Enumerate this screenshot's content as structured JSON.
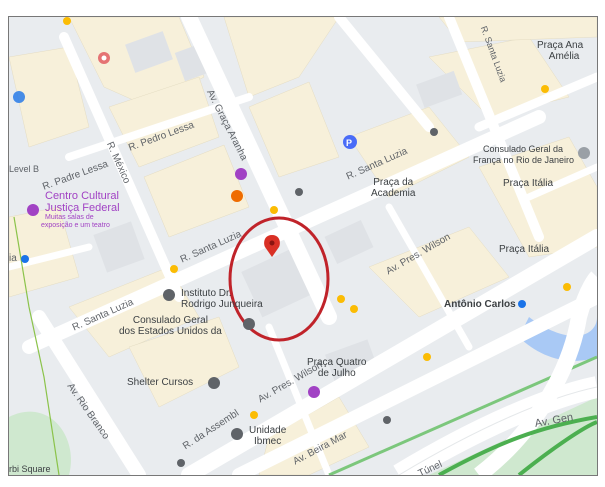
{
  "map": {
    "streets": {
      "av_graca_aranha": "Av. Graça Aranha",
      "r_pedro_lessa": "R. Pedro Lessa",
      "r_mexico": "R. México",
      "r_padre_lessa": "R. Padre Lessa",
      "r_santa_luzia_top": "R. Santa Luzia",
      "r_santa_luzia_mid": "R. Santa Luzia",
      "r_santa_luzia_left": "R. Santa Luzia",
      "av_pres_wilson_right": "Av. Pres. Wilson",
      "av_pres_wilson_left": "Av. Pres. Wilson",
      "av_beira_mar": "Av. Beira Mar",
      "av_rio_branco": "Av. Rio Branco",
      "av_gen": "Av. Gen",
      "r_da_assembleia": "R. da Assembl",
      "tunnel": "Túnel",
      "level_b": "Level B",
      "r_edge": "ia"
    },
    "places": {
      "praca_ana_amelia_1": "Praça Ana",
      "praca_ana_amelia_2": "Amélia",
      "consulado_franca_1": "Consulado Geral da",
      "consulado_franca_2": "França no Rio de Janeiro",
      "praca_italia_1": "Praça Itália",
      "praca_italia_2": "Praça Itália",
      "praca_da_academia_1": "Praça da",
      "praca_da_academia_2": "Academia",
      "centro_cultural_1": "Centro Cultural",
      "centro_cultural_2": "Justiça Federal",
      "centro_cultural_3": "Muitas salas de",
      "centro_cultural_4": "exposição e um teatro",
      "instituto_1": "Instituto Dr.",
      "instituto_2": "Rodrigo Junqueira",
      "consulado_eua_1": "Consulado Geral",
      "consulado_eua_2": "dos Estados Unidos da",
      "antonio_carlos": "Antônio Carlos",
      "praca_quatro_1": "Praça Quatro",
      "praca_quatro_2": "de Julho",
      "shelter": "Shelter Cursos",
      "ibmec_1": "Unidade",
      "ibmec_2": "Ibmec",
      "bottom_left": "rbi Square"
    },
    "marker": {
      "icon": "red-pin",
      "highlight_color": "#c0232a"
    },
    "colors": {
      "road": "#ffffff",
      "block": "#f8f1dc",
      "background": "#e7ebee",
      "water": "#aecbfa",
      "park": "#c8e6c9",
      "poi_purple": "#a142c4"
    }
  }
}
